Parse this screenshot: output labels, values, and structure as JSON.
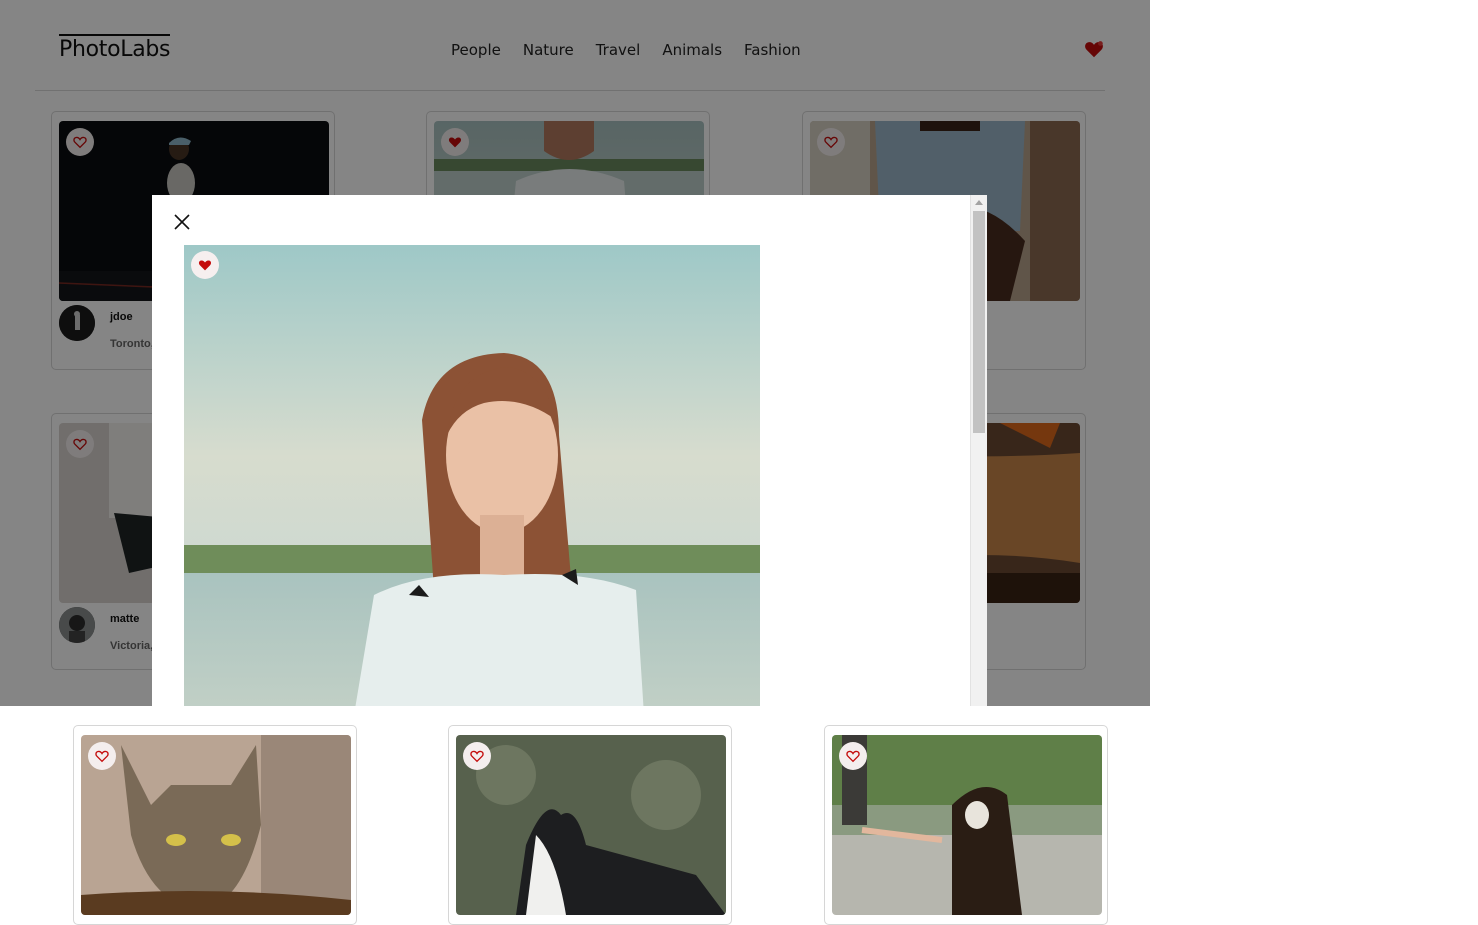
{
  "app": {
    "logo": "PhotoLabs",
    "topics": [
      "People",
      "Nature",
      "Travel",
      "Animals",
      "Fashion"
    ],
    "fav_badge_icon": "heart-icon",
    "accent": "#c40c0c"
  },
  "photos": [
    {
      "username": "jdoe",
      "location": "Toronto,",
      "favorited": false
    },
    {
      "favorited": true
    },
    {
      "favorited": false
    },
    {
      "username": "matte",
      "location": "Victoria,",
      "favorited": false
    },
    {
      "favorited": false
    },
    {
      "favorited": false
    },
    {
      "favorited": false
    }
  ],
  "modal": {
    "close_icon": "close-icon",
    "photo_favorited": true
  }
}
